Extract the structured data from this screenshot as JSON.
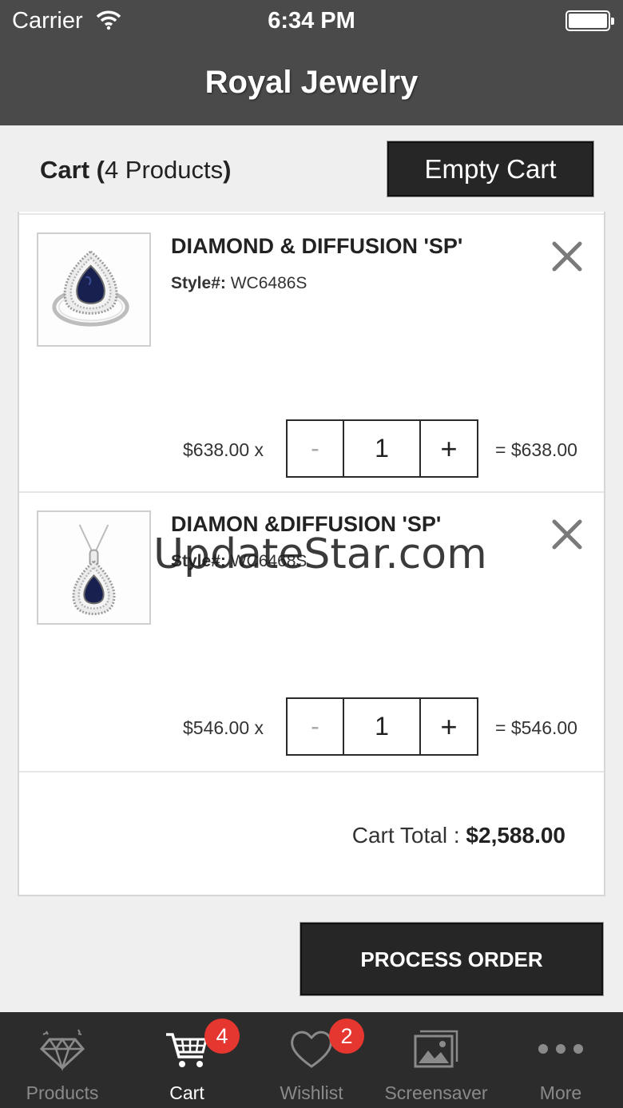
{
  "status_bar": {
    "carrier": "Carrier",
    "time": "6:34 PM"
  },
  "nav": {
    "title": "Royal Jewelry"
  },
  "cart": {
    "heading_strong": "Cart (",
    "heading_count": "4 Products",
    "heading_close": ")",
    "empty_label": "Empty Cart",
    "items": [
      {
        "name": "DIAMOND & DIFFUSION 'SP'",
        "style_label": "Style#:",
        "style": "WC6486S",
        "unit_price": "$638.00 x",
        "minus": "-",
        "qty": "1",
        "plus": "+",
        "line_total": "= $638.00",
        "image": "sapphire-ring-image"
      },
      {
        "name": "DIAMON &DIFFUSION 'SP'",
        "style_label": "Style#:",
        "style": "WC6468S",
        "unit_price": "$546.00 x",
        "minus": "-",
        "qty": "1",
        "plus": "+",
        "line_total": "= $546.00",
        "image": "sapphire-pendant-image"
      }
    ],
    "total_label": "Cart Total : ",
    "total_value": "$2,588.00",
    "process_label": "PROCESS ORDER"
  },
  "watermark": "UpdateStar.com",
  "tabbar": {
    "tabs": [
      {
        "label": "Products",
        "icon": "diamond-icon"
      },
      {
        "label": "Cart",
        "icon": "cart-icon",
        "badge": "4",
        "active": true
      },
      {
        "label": "Wishlist",
        "icon": "heart-icon",
        "badge": "2"
      },
      {
        "label": "Screensaver",
        "icon": "picture-icon"
      },
      {
        "label": "More",
        "icon": "more-icon"
      }
    ]
  },
  "colors": {
    "bar": "#4a4a4a",
    "button": "#262626",
    "badge": "#e53630",
    "tabbar": "#2c2c2c"
  }
}
